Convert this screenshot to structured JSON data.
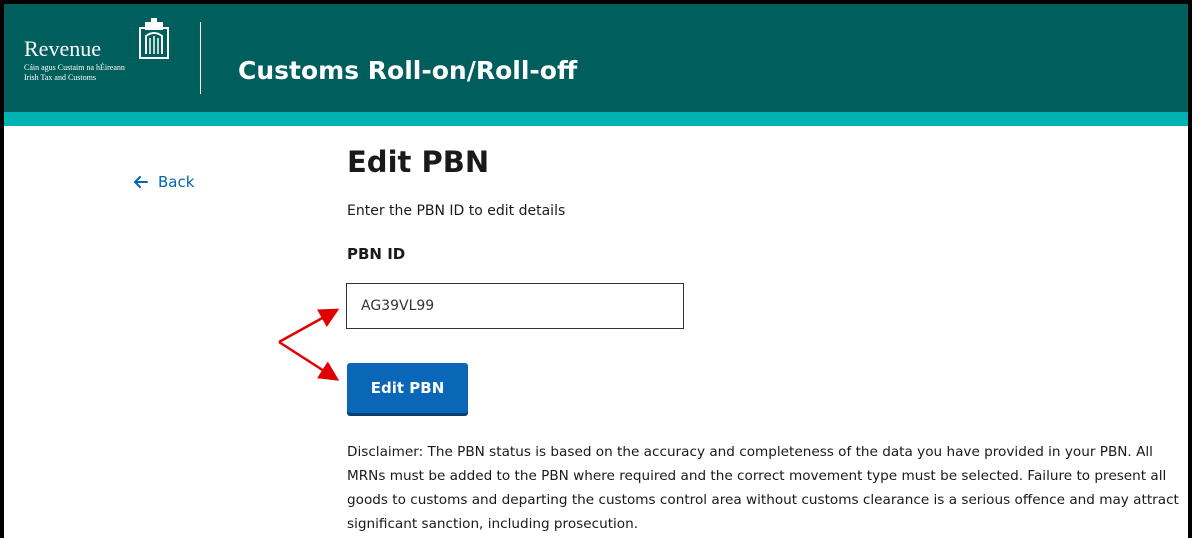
{
  "header": {
    "brand_name": "Revenue",
    "brand_line_irish": "Cáin agus Custaim na hÉireann",
    "brand_line_english": "Irish Tax and Customs",
    "app_title": "Customs Roll-on/Roll-off",
    "colors": {
      "bar": "#005e5d",
      "stripe": "#00b2b1"
    }
  },
  "nav": {
    "back_label": "Back",
    "back_icon": "arrow-left-icon"
  },
  "page": {
    "title": "Edit PBN",
    "intro": "Enter the PBN ID to edit details"
  },
  "form": {
    "pbn_label": "PBN ID",
    "pbn_value": "AG39VL99",
    "submit_label": "Edit PBN",
    "button_color": "#0a66b6"
  },
  "disclaimer": "Disclaimer: The PBN status is based on the accuracy and completeness of the data you have provided in your PBN. All MRNs must be added to the PBN where required and the correct movement type must be selected. Failure to present all goods to customs and departing the customs control area without customs clearance is a serious offence and may attract significant sanction, including prosecution.",
  "annotation": {
    "color": "#e00000",
    "icon": "red-arrows-annotation"
  }
}
